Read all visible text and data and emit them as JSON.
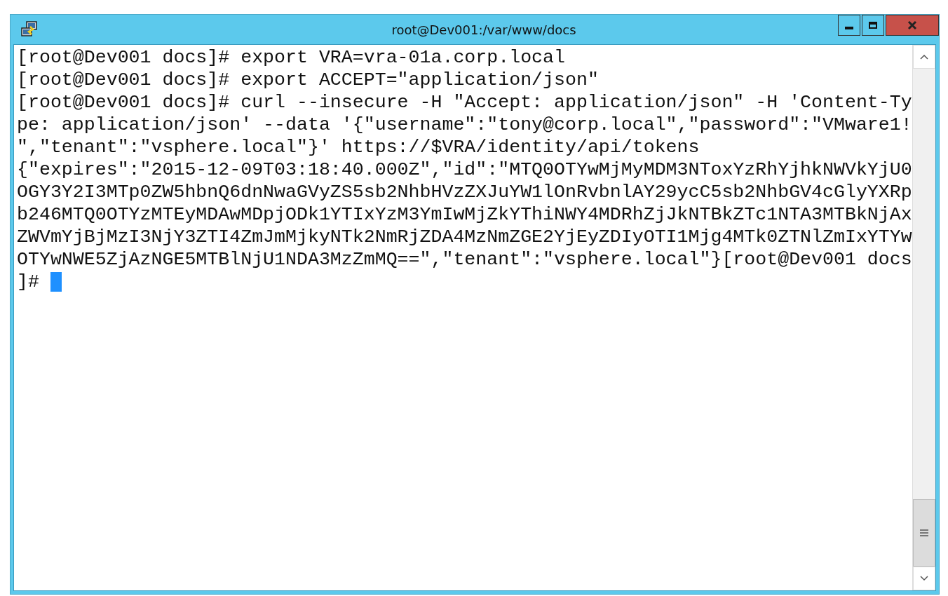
{
  "window": {
    "title": "root@Dev001:/var/www/docs"
  },
  "terminal": {
    "lines": [
      "[root@Dev001 docs]# export VRA=vra-01a.corp.local",
      "[root@Dev001 docs]# export ACCEPT=\"application/json\"",
      "[root@Dev001 docs]# curl --insecure -H \"Accept: application/json\" -H 'Content-Ty",
      "pe: application/json' --data '{\"username\":\"tony@corp.local\",\"password\":\"VMware1!",
      "\",\"tenant\":\"vsphere.local\"}' https://$VRA/identity/api/tokens",
      "{\"expires\":\"2015-12-09T03:18:40.000Z\",\"id\":\"MTQ0OTYwMjMyMDM3NToxYzRhYjhkNWVkYjU0",
      "OGY3Y2I3MTp0ZW5hbnQ6dnNwaGVyZS5sb2NhbHVzZXJuYW1lOnRvbnlAY29ycC5sb2NhbGV4cGlyYXRp",
      "b246MTQ0OTYzMTEyMDAwMDpjODk1YTIxYzM3YmIwMjZkYThiNWY4MDRhZjJkNTBkZTc1NTA3MTBkNjAx",
      "ZWVmYjBjMzI3NjY3ZTI4ZmJmMjkyNTk2NmRjZDA4MzNmZGE2YjEyZDIyOTI1Mjg4MTk0ZTNlZmIxYTYw",
      "OTYwNWE5ZjAzNGE5MTBlNjU1NDA3MzZmMQ==\",\"tenant\":\"vsphere.local\"}[root@Dev001 docs"
    ],
    "prompt": "]#"
  }
}
